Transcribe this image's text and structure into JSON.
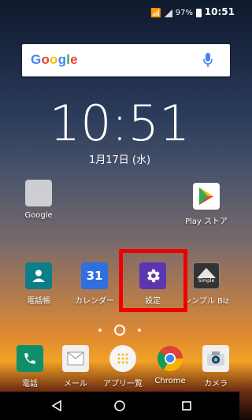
{
  "status_bar": {
    "battery_text": "97%",
    "time": "10:51"
  },
  "search_widget": {
    "logo_letters": [
      "G",
      "o",
      "o",
      "g",
      "l",
      "e"
    ]
  },
  "clock_widget": {
    "time": "10:51",
    "date": "1月17日 (水)"
  },
  "home_apps_row1": [
    {
      "label": "Google",
      "icon": "google-folder-icon"
    },
    {
      "label": "Play ストア",
      "icon": "play-store-icon"
    }
  ],
  "home_apps_row2": [
    {
      "label": "電話帳",
      "icon": "contacts-icon"
    },
    {
      "label": "カレンダー",
      "icon": "calendar-icon",
      "badge": "31"
    },
    {
      "label": "設定",
      "icon": "settings-gear-icon"
    },
    {
      "label": "シンプル Biz",
      "icon": "simple-biz-icon",
      "badge": "Simple"
    }
  ],
  "dock_apps": [
    {
      "label": "電話",
      "icon": "phone-icon"
    },
    {
      "label": "メール",
      "icon": "mail-icon"
    },
    {
      "label": "アプリ一覧",
      "icon": "app-drawer-icon"
    },
    {
      "label": "Chrome",
      "icon": "chrome-icon"
    },
    {
      "label": "カメラ",
      "icon": "camera-icon"
    }
  ],
  "colors": {
    "highlight_border": "#ee0000",
    "settings_icon_bg": "#5e35b1",
    "contacts_icon_bg": "#0a7f8a",
    "phone_icon_bg": "#0d8f6a",
    "calendar_icon_bg": "#2f6fe0"
  }
}
